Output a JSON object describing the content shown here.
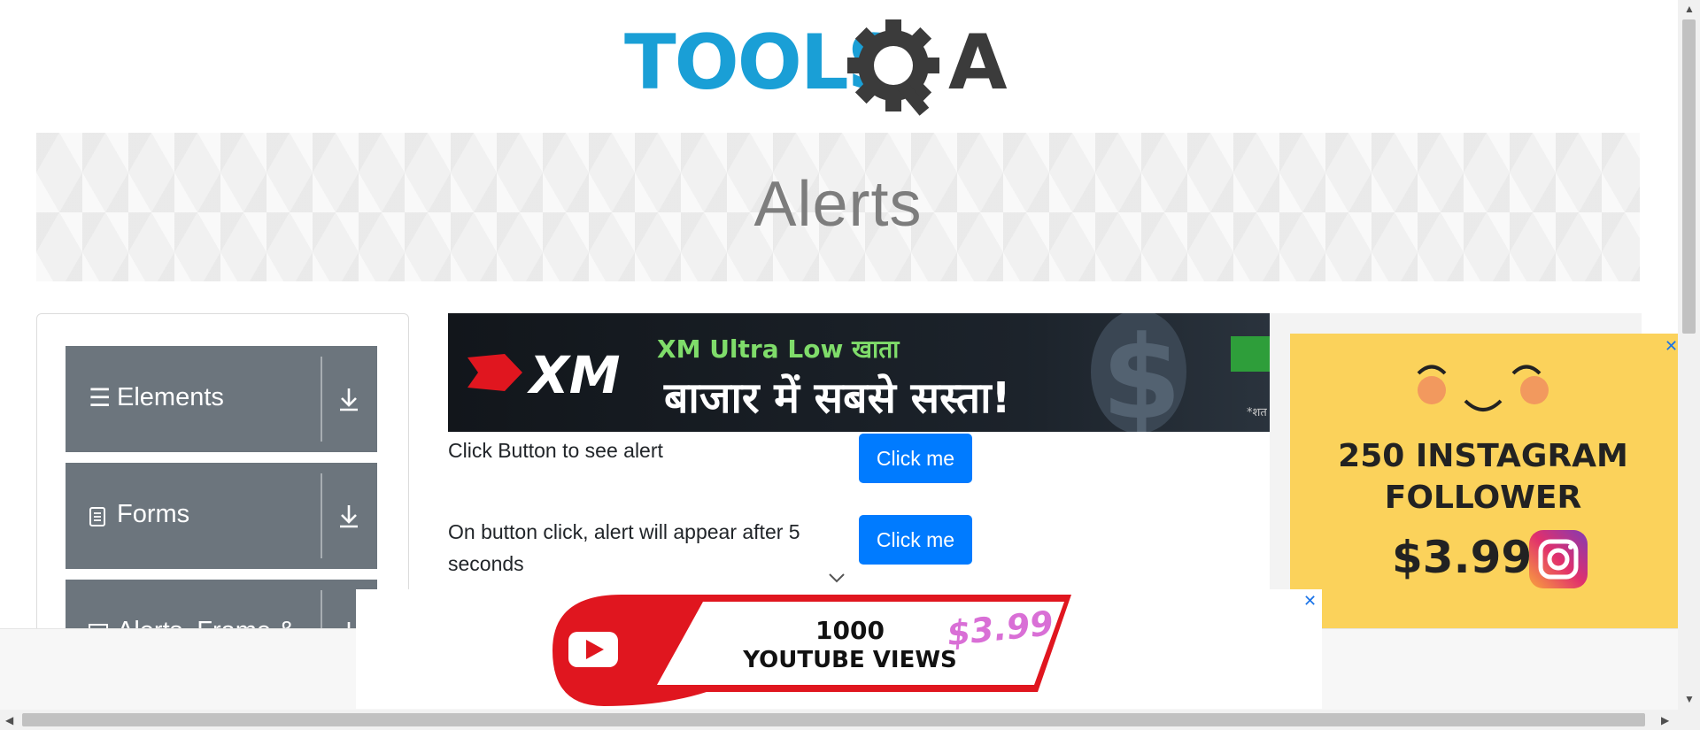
{
  "logo": {
    "text_left": "TOOLS",
    "text_right": "A"
  },
  "page": {
    "title": "Alerts"
  },
  "sidebar": {
    "groups": [
      {
        "label": "Elements",
        "icon": "hamburger-icon"
      },
      {
        "label": "Forms",
        "icon": "document-icon"
      },
      {
        "label": "Alerts, Frame &",
        "icon": "window-icon"
      }
    ]
  },
  "ads": {
    "top": {
      "brand": "XM",
      "line1": "XM Ultra Low खाता",
      "line2": "बाजार में सबसे सस्ता!",
      "footnote": "*शत"
    },
    "right": {
      "headline": "250 INSTAGRAM\nFOLLOWER",
      "price": "$3.99"
    },
    "bottom": {
      "line1": "1000",
      "line2": "YOUTUBE VIEWS",
      "price": "$3.99"
    }
  },
  "alerts": [
    {
      "text": "Click Button to see alert",
      "button": "Click me"
    },
    {
      "text": "On button click, alert will appear after 5 seconds",
      "button": "Click me"
    }
  ],
  "colors": {
    "brand_blue": "#1a9fd6",
    "brand_dark": "#3b3b3b",
    "sidebar_bg": "#6c757d",
    "button_bg": "#007bff",
    "ad_yellow": "#fbd25b",
    "ad_red": "#e0161f"
  }
}
